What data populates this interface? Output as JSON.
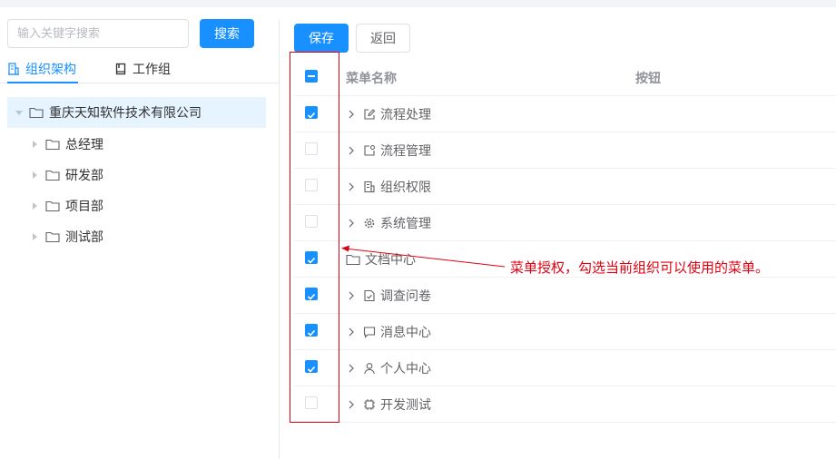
{
  "search": {
    "placeholder": "输入关键字搜索",
    "button_label": "搜索"
  },
  "tabs": [
    {
      "label": "组织架构",
      "icon": "building-icon",
      "active": true
    },
    {
      "label": "工作组",
      "icon": "book-icon",
      "active": false
    }
  ],
  "tree": {
    "root": {
      "label": "重庆天知软件技术有限公司",
      "expanded": true
    },
    "children": [
      {
        "label": "总经理"
      },
      {
        "label": "研发部"
      },
      {
        "label": "项目部"
      },
      {
        "label": "测试部"
      }
    ]
  },
  "toolbar": {
    "save_label": "保存",
    "back_label": "返回"
  },
  "table": {
    "header": {
      "select_all_state": "indeterminate",
      "col_name": "菜单名称",
      "col_buttons": "按钮"
    },
    "rows": [
      {
        "label": "流程处理",
        "icon": "edit-icon",
        "checked": true,
        "expandable": true
      },
      {
        "label": "流程管理",
        "icon": "process-settings-icon",
        "checked": false,
        "expandable": true
      },
      {
        "label": "组织权限",
        "icon": "building-icon",
        "checked": false,
        "expandable": true
      },
      {
        "label": "系统管理",
        "icon": "gear-icon",
        "checked": false,
        "expandable": true
      },
      {
        "label": "文档中心",
        "icon": "folder-icon",
        "checked": true,
        "expandable": false
      },
      {
        "label": "调查问卷",
        "icon": "survey-icon",
        "checked": true,
        "expandable": true
      },
      {
        "label": "消息中心",
        "icon": "chat-icon",
        "checked": true,
        "expandable": true
      },
      {
        "label": "个人中心",
        "icon": "user-icon",
        "checked": true,
        "expandable": true
      },
      {
        "label": "开发测试",
        "icon": "chip-icon",
        "checked": false,
        "expandable": true
      }
    ]
  },
  "annotation": {
    "text": "菜单授权，勾选当前组织可以使用的菜单。"
  },
  "colors": {
    "primary": "#1890ff",
    "annotation_red": "#e0000f",
    "tree_selected_bg": "#e6f4ff"
  }
}
